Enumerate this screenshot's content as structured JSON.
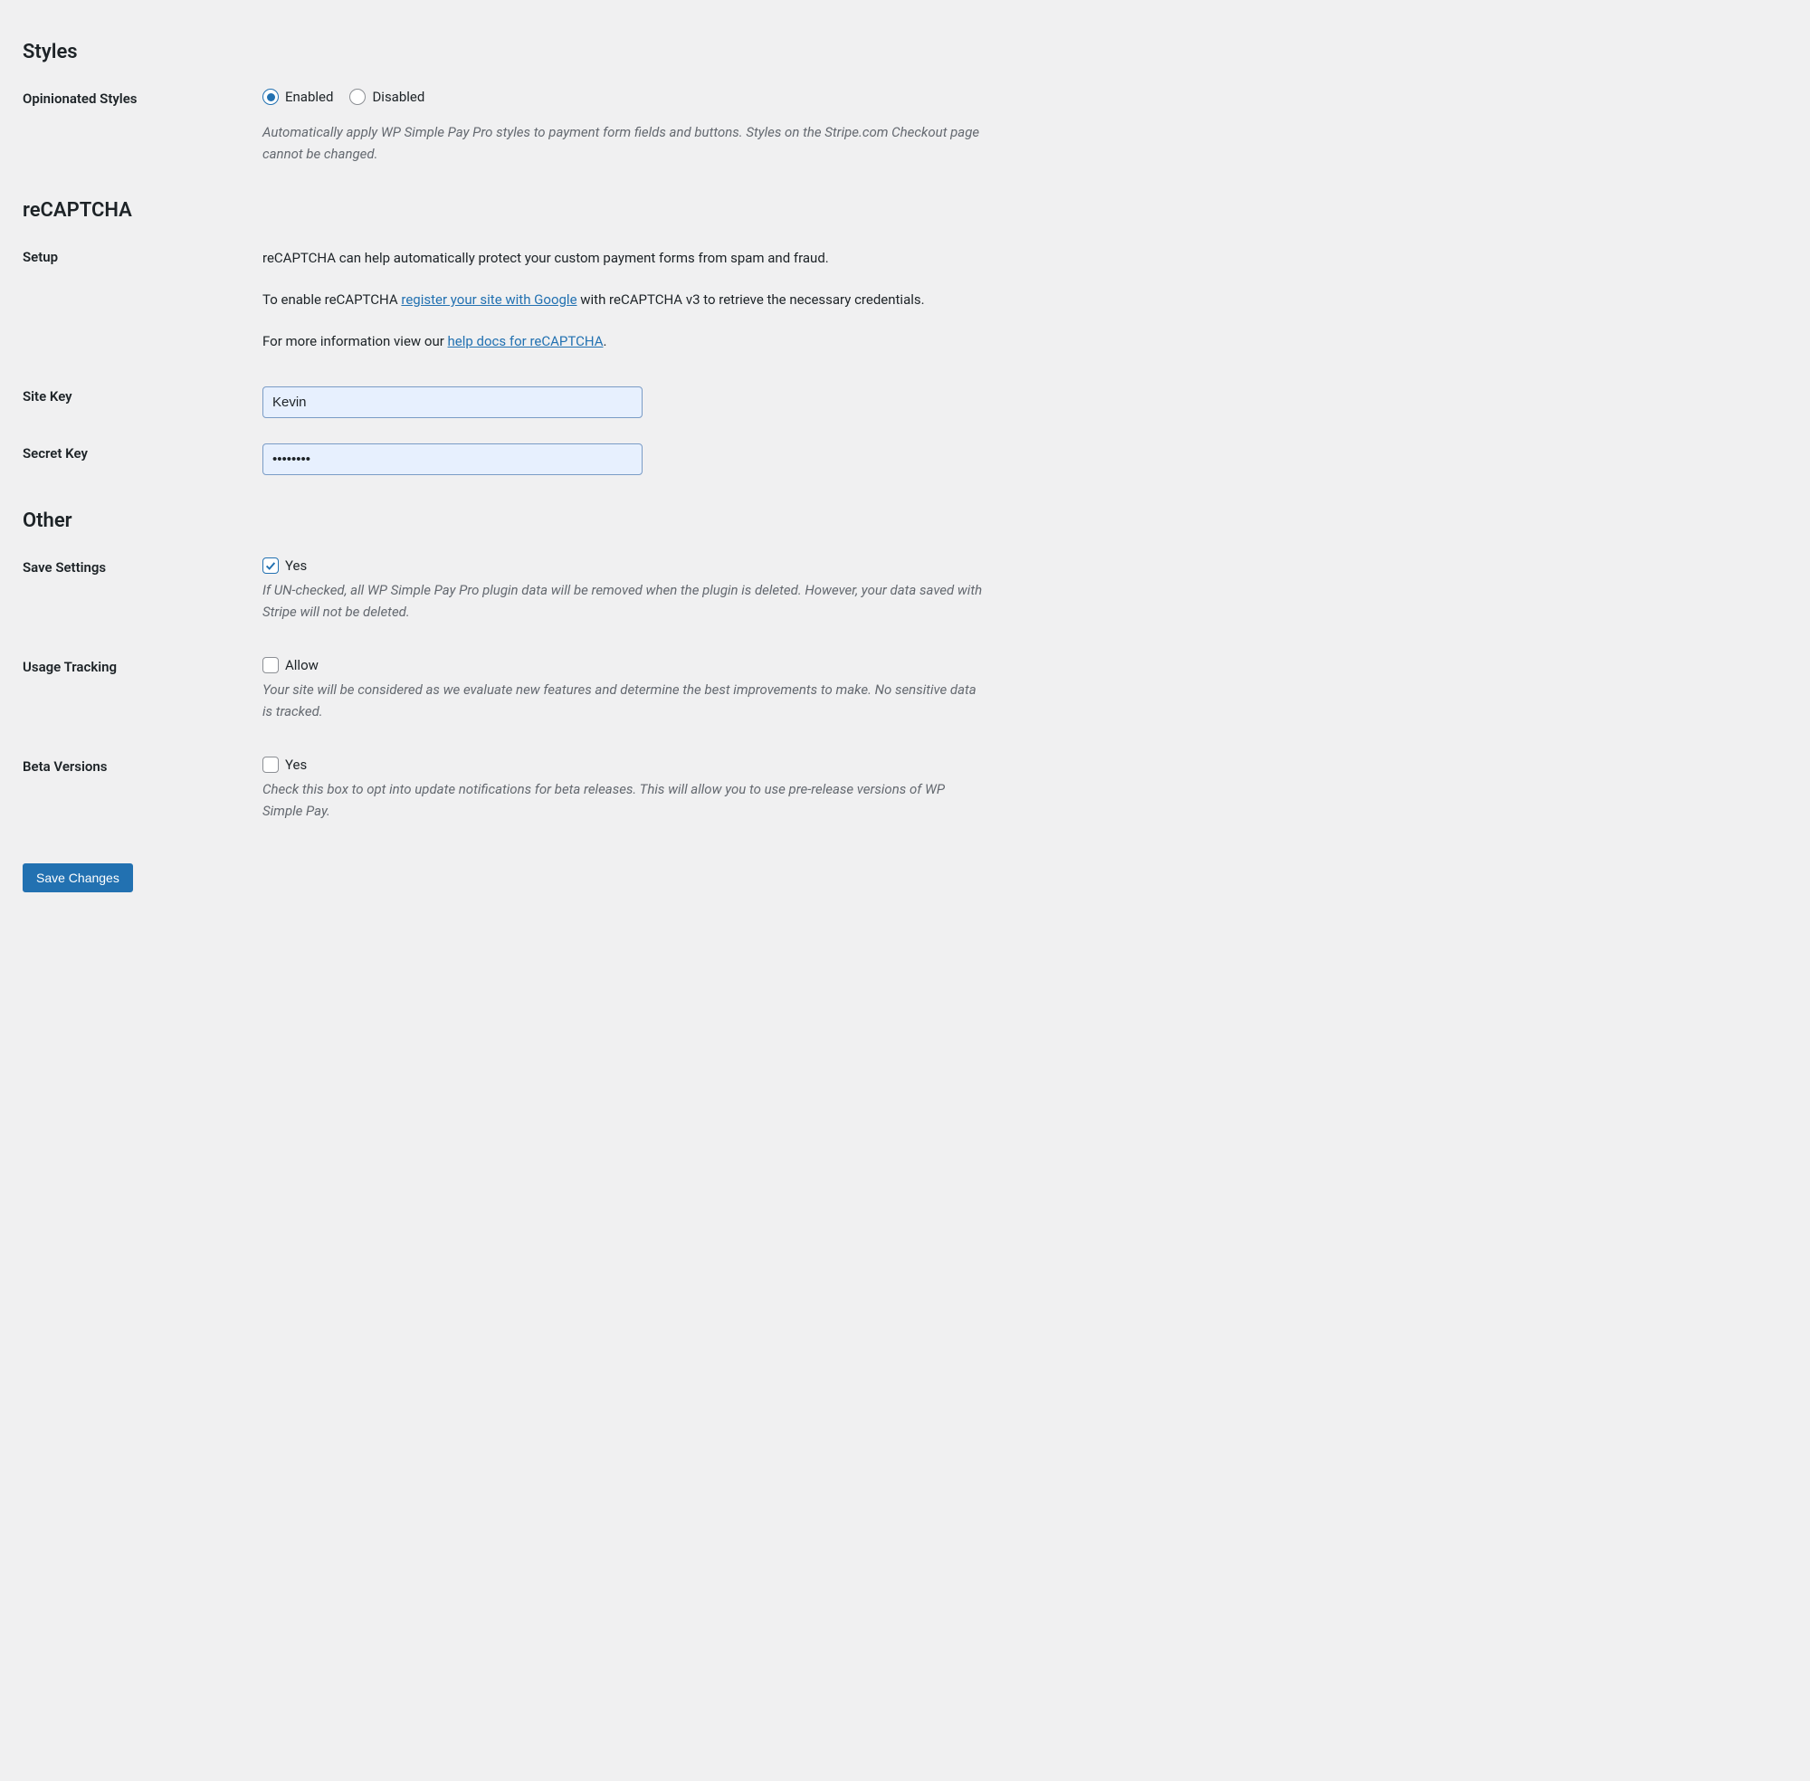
{
  "sections": {
    "styles": {
      "heading": "Styles"
    },
    "recaptcha": {
      "heading": "reCAPTCHA"
    },
    "other": {
      "heading": "Other"
    }
  },
  "opinionated_styles": {
    "label": "Opinionated Styles",
    "enabled_label": "Enabled",
    "disabled_label": "Disabled",
    "value": "enabled",
    "description": "Automatically apply WP Simple Pay Pro styles to payment form fields and buttons. Styles on the Stripe.com Checkout page cannot be changed."
  },
  "setup": {
    "label": "Setup",
    "para1": "reCAPTCHA can help automatically protect your custom payment forms from spam and fraud.",
    "para2_prefix": "To enable reCAPTCHA ",
    "para2_link": "register your site with Google",
    "para2_suffix": " with reCAPTCHA v3 to retrieve the necessary credentials.",
    "para3_prefix": "For more information view our ",
    "para3_link": "help docs for reCAPTCHA",
    "para3_suffix": "."
  },
  "site_key": {
    "label": "Site Key",
    "value": "Kevin"
  },
  "secret_key": {
    "label": "Secret Key",
    "value": "••••••••"
  },
  "save_settings": {
    "label": "Save Settings",
    "checkbox_label": "Yes",
    "checked": true,
    "description": "If UN-checked, all WP Simple Pay Pro plugin data will be removed when the plugin is deleted. However, your data saved with Stripe will not be deleted."
  },
  "usage_tracking": {
    "label": "Usage Tracking",
    "checkbox_label": "Allow",
    "checked": false,
    "description": "Your site will be considered as we evaluate new features and determine the best improvements to make. No sensitive data is tracked."
  },
  "beta_versions": {
    "label": "Beta Versions",
    "checkbox_label": "Yes",
    "checked": false,
    "description": "Check this box to opt into update notifications for beta releases. This will allow you to use pre-release versions of WP Simple Pay."
  },
  "save_button": {
    "label": "Save Changes"
  }
}
